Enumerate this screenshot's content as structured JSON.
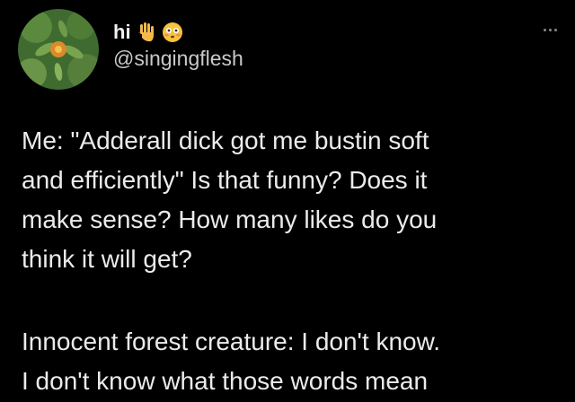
{
  "tweet": {
    "author": {
      "display_name": "hi",
      "emojis": [
        "raised-hand-emoji",
        "flushed-face-emoji"
      ],
      "handle": "@singingflesh",
      "avatar": "flower-avatar"
    },
    "more_icon": "more-options-icon",
    "paragraphs": [
      "Me: \"Adderall dick got me bustin soft\nand efficiently\" Is that funny? Does it\nmake sense? How many likes do you\nthink it will get?",
      "Innocent forest creature: I don't know.\nI don't know what those words mean"
    ]
  },
  "colors": {
    "background": "#000000",
    "text": "#ebebeb",
    "handle": "#c9c9c9"
  }
}
